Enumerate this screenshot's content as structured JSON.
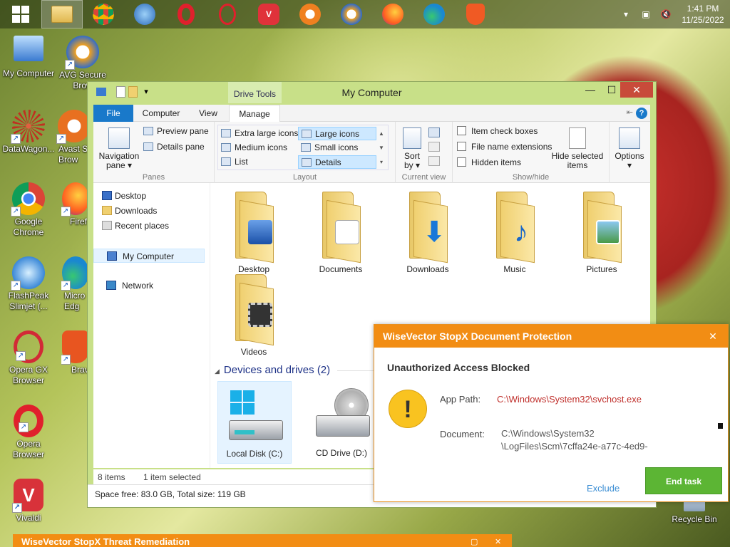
{
  "taskbar": {
    "apps": [
      "start",
      "file-explorer",
      "chrome",
      "slimjet",
      "opera",
      "opera-gx",
      "vivaldi",
      "avast",
      "avg",
      "firefox",
      "edge",
      "brave"
    ],
    "clock_time": "1:41 PM",
    "clock_date": "11/25/2022"
  },
  "desktop": {
    "icons": [
      {
        "label": "My Computer",
        "color": "#3a7ad0"
      },
      {
        "label": "AVG Secure Brow",
        "color": "#f0a020"
      },
      {
        "label": "DataWagon...",
        "color": "#c03020"
      },
      {
        "label": "Avast S Brow",
        "color": "#e87020"
      },
      {
        "label": "Google Chrome",
        "color": "#dd4b39"
      },
      {
        "label": "Firef",
        "color": "#ff7a20"
      },
      {
        "label": "FlashPeak Slimjet (...",
        "color": "#3a88d8"
      },
      {
        "label": "Micro Edg",
        "color": "#1a88d0"
      },
      {
        "label": "Opera GX Browser",
        "color": "#d22a36"
      },
      {
        "label": "Brav",
        "color": "#e85520"
      },
      {
        "label": "Opera Browser",
        "color": "#e0202c"
      },
      {
        "label": "Vivaldi",
        "color": "#d8323a"
      },
      {
        "label": "Recycle Bin",
        "color": "#8aa0b8"
      }
    ]
  },
  "explorer": {
    "title": "My Computer",
    "drive_tools": "Drive Tools",
    "tabs": {
      "file": "File",
      "computer": "Computer",
      "view": "View",
      "manage": "Manage"
    },
    "ribbon": {
      "navigation_pane": "Navigation pane",
      "preview_pane": "Preview pane",
      "details_pane": "Details pane",
      "panes_label": "Panes",
      "extra_large_icons": "Extra large icons",
      "large_icons": "Large icons",
      "medium_icons": "Medium icons",
      "small_icons": "Small icons",
      "list": "List",
      "details": "Details",
      "layout_label": "Layout",
      "sort_by": "Sort by",
      "current_view_label": "Current view",
      "item_check_boxes": "Item check boxes",
      "file_name_extensions": "File name extensions",
      "hidden_items": "Hidden items",
      "hide_selected_items": "Hide selected items",
      "show_hide_label": "Show/hide",
      "options": "Options"
    },
    "nav": {
      "desktop": "Desktop",
      "downloads": "Downloads",
      "recent_places": "Recent places",
      "my_computer": "My Computer",
      "network": "Network"
    },
    "folders": {
      "desktop": "Desktop",
      "documents": "Documents",
      "downloads": "Downloads",
      "music": "Music",
      "pictures": "Pictures",
      "videos": "Videos"
    },
    "devices_header": "Devices and drives (2)",
    "drives": {
      "local_disk": "Local Disk (C:)",
      "cd_drive": "CD Drive (D:)"
    },
    "status": {
      "items": "8 items",
      "selected": "1 item selected"
    },
    "space": "Space free: 83.0 GB, Total size: 119 GB"
  },
  "alert": {
    "title": "WiseVector StopX Document Protection",
    "subtitle": "Unauthorized Access Blocked",
    "app_path_label": "App Path:",
    "app_path_value": "C:\\Windows\\System32\\svchost.exe",
    "document_label": "Document:",
    "document_line1": "C:\\Windows\\System32",
    "document_line2": "\\LogFiles\\Scm\\7cffa24e-a77c-4ed9-",
    "exclude": "Exclude",
    "end_task": "End task",
    "accent": "#f28d14"
  },
  "remediation": {
    "title": "WiseVector StopX Threat Remediation"
  }
}
